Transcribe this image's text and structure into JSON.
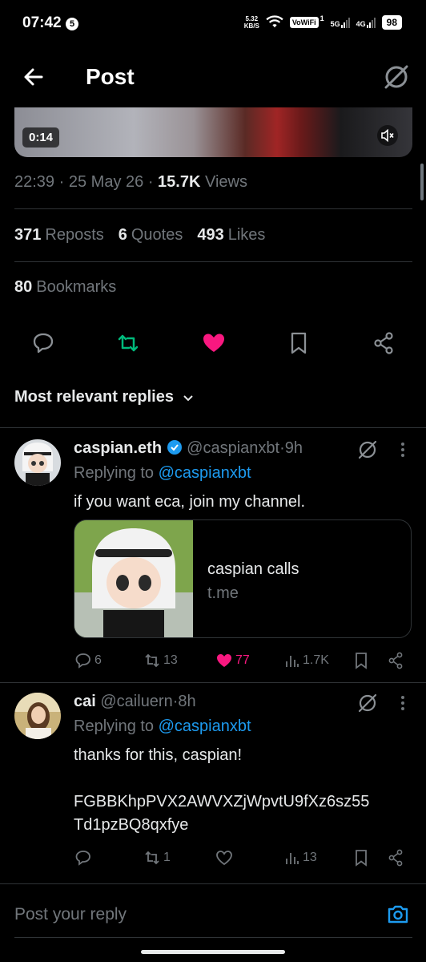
{
  "status_bar": {
    "time": "07:42",
    "notif_badge": "5",
    "speed_value": "5.32",
    "speed_unit": "KB/S",
    "vowifi": "VoWiFi",
    "sim1": "1",
    "net1": "5G",
    "net2": "4G",
    "battery": "98"
  },
  "header": {
    "title": "Post"
  },
  "video": {
    "duration": "0:14"
  },
  "post_meta": {
    "time": "22:39",
    "date": "25 May 26",
    "views_count": "15.7K",
    "views_label": "Views",
    "sep": "·"
  },
  "stats": {
    "reposts_count": "371",
    "reposts_label": "Reposts",
    "quotes_count": "6",
    "quotes_label": "Quotes",
    "likes_count": "493",
    "likes_label": "Likes",
    "bookmarks_count": "80",
    "bookmarks_label": "Bookmarks"
  },
  "colors": {
    "accent": "#1d9bf0",
    "like": "#f91880",
    "repost": "#00ba7c",
    "muted": "#71767b"
  },
  "sort": {
    "label": "Most relevant replies"
  },
  "replies": [
    {
      "name": "caspian.eth",
      "verified": true,
      "handle": "@caspianxbt",
      "age": "9h",
      "replying_prefix": "Replying to",
      "replying_to": "@caspianxbt",
      "text": "if you want eca, join my channel.",
      "card_title": "caspian calls",
      "card_domain": "t.me",
      "replies": "6",
      "reposts": "13",
      "likes": "77",
      "views": "1.7K",
      "liked": true
    },
    {
      "name": "cai",
      "verified": false,
      "handle": "@cailuern",
      "age": "8h",
      "replying_prefix": "Replying to",
      "replying_to": "@caspianxbt",
      "text_line1": "thanks for this, caspian!",
      "text_line2": "FGBBKhpPVX2AWVXZjWpvtU9fXz6sz55",
      "text_line3": "Td1pzBQ8qxfye",
      "replies": "",
      "reposts": "1",
      "likes": "",
      "views": "13",
      "liked": false
    }
  ],
  "composer": {
    "placeholder": "Post your reply"
  }
}
